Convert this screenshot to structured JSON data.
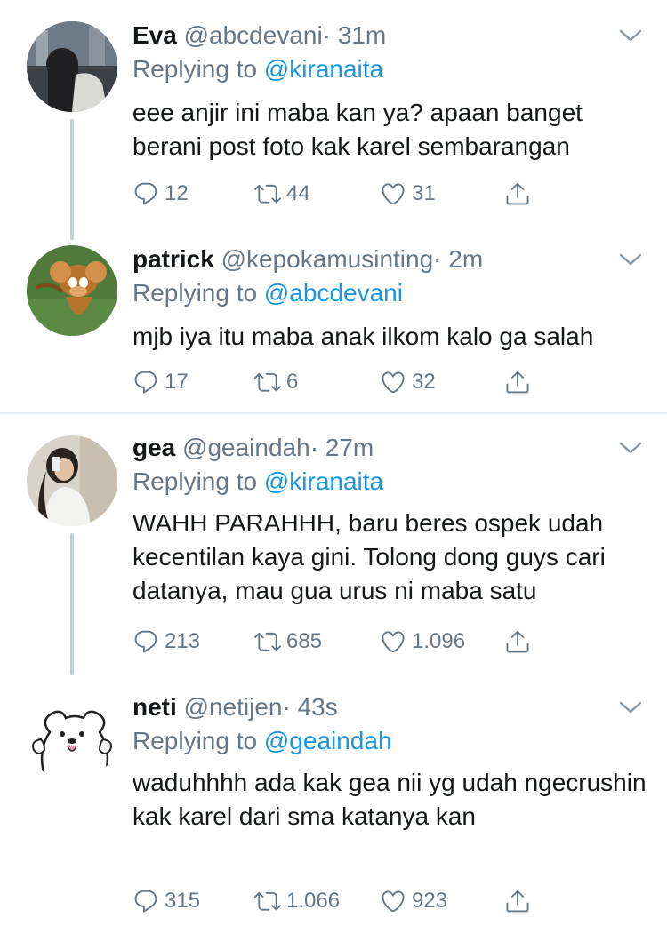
{
  "tweets": [
    {
      "name": "Eva",
      "handle": "@abcdevani",
      "time": "· 31m",
      "replying_prefix": "Replying to ",
      "replying_to": "@kiranaita",
      "text": "eee anjir ini maba kan ya? apaan banget berani post foto kak karel sembarangan",
      "replies": "12",
      "retweets": "44",
      "likes": "31"
    },
    {
      "name": "patrick",
      "handle": "@kepokamusinting",
      "time": "· 2m",
      "replying_prefix": "Replying to ",
      "replying_to": "@abcdevani",
      "text": "mjb iya itu maba anak ilkom kalo ga salah",
      "replies": "17",
      "retweets": "6",
      "likes": "32"
    },
    {
      "name": "gea",
      "handle": "@geaindah",
      "time": "· 27m",
      "replying_prefix": "Replying to ",
      "replying_to": "@kiranaita",
      "text": "WAHH PARAHHH, baru beres ospek udah kecentilan kaya gini. Tolong dong guys cari datanya, mau gua urus ni maba satu",
      "replies": "213",
      "retweets": "685",
      "likes": "1.096"
    },
    {
      "name": "neti",
      "handle": "@netijen",
      "time": "· 43s",
      "replying_prefix": "Replying to ",
      "replying_to": "@geaindah",
      "text": "waduhhhh ada kak gea nii yg udah ngecrushin kak karel dari sma katanya kan",
      "replies": "315",
      "retweets": "1.066",
      "likes": "923"
    }
  ],
  "colors": {
    "text": "#14171a",
    "secondary": "#657786",
    "link": "#1b95e0",
    "divider": "#e6ecf0",
    "thread_line": "#c4cfd6"
  },
  "icons": {
    "reply": "reply-bubble-icon",
    "retweet": "retweet-icon",
    "like": "heart-icon",
    "share": "share-icon",
    "menu": "chevron-down-icon"
  }
}
